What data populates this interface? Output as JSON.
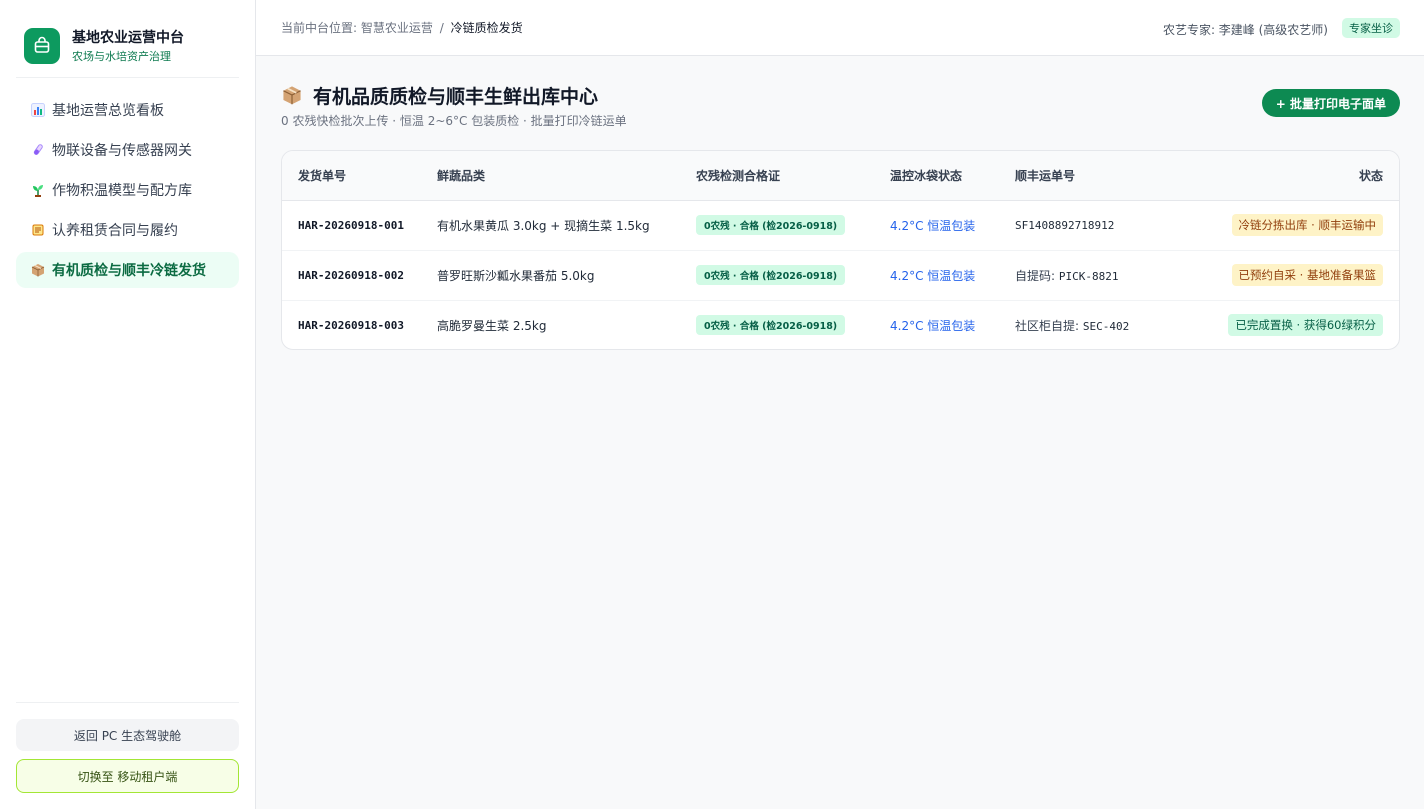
{
  "brand": {
    "title": "基地农业运营中台",
    "subtitle": "农场与水培资产治理",
    "logo_icon": "basket-icon",
    "accent_color": "#0d9a5f"
  },
  "sidebar": {
    "items": [
      {
        "label": "基地运营总览看板",
        "icon": "bar-chart-icon",
        "active": false
      },
      {
        "label": "物联设备与传感器网关",
        "icon": "test-tube-icon",
        "active": false
      },
      {
        "label": "作物积温模型与配方库",
        "icon": "seedling-icon",
        "active": false
      },
      {
        "label": "认养租赁合同与履约",
        "icon": "scroll-icon",
        "active": false
      },
      {
        "label": "有机质检与顺丰冷链发货",
        "icon": "package-icon",
        "active": true
      }
    ],
    "return_label": "返回 PC 生态驾驶舱",
    "switch_label": "切换至 移动租户端"
  },
  "topbar": {
    "breadcrumb_prefix": "当前中台位置:",
    "breadcrumb_parent": "智慧农业运营",
    "breadcrumb_sep": "/",
    "breadcrumb_current": "冷链质检发货",
    "expert_text": "农艺专家: 李建峰 (高级农艺师)",
    "expert_badge": "专家坐诊"
  },
  "page": {
    "title": "有机品质质检与顺丰生鲜出库中心",
    "title_icon": "package-icon",
    "subtitle": "0 农残快检批次上传 · 恒温 2~6°C 包装质检 · 批量打印冷链运单",
    "print_button": "+ 批量打印电子面单"
  },
  "table": {
    "columns": [
      "发货单号",
      "鲜蔬品类",
      "农残检测合格证",
      "温控冰袋状态",
      "顺丰运单号",
      "状态"
    ],
    "rows": [
      {
        "order_id": "HAR-20260918-001",
        "product": "有机水果黄瓜 3.0kg + 现摘生菜 1.5kg",
        "qc": "0农残 · 合格 (检2026-0918)",
        "temp": "4.2°C 恒温包装",
        "tracking_prefix": "",
        "tracking_code": "SF1408892718912",
        "status": "冷链分拣出库 · 顺丰运输中",
        "status_color": "amber"
      },
      {
        "order_id": "HAR-20260918-002",
        "product": "普罗旺斯沙瓤水果番茄 5.0kg",
        "qc": "0农残 · 合格 (检2026-0918)",
        "temp": "4.2°C 恒温包装",
        "tracking_prefix": "自提码:",
        "tracking_code": "PICK-8821",
        "status": "已预约自采 · 基地准备果篮",
        "status_color": "amber"
      },
      {
        "order_id": "HAR-20260918-003",
        "product": "高脆罗曼生菜 2.5kg",
        "qc": "0农残 · 合格 (检2026-0918)",
        "temp": "4.2°C 恒温包装",
        "tracking_prefix": "社区柜自提:",
        "tracking_code": "SEC-402",
        "status": "已完成置换 · 获得60绿积分",
        "status_color": "green"
      }
    ]
  }
}
